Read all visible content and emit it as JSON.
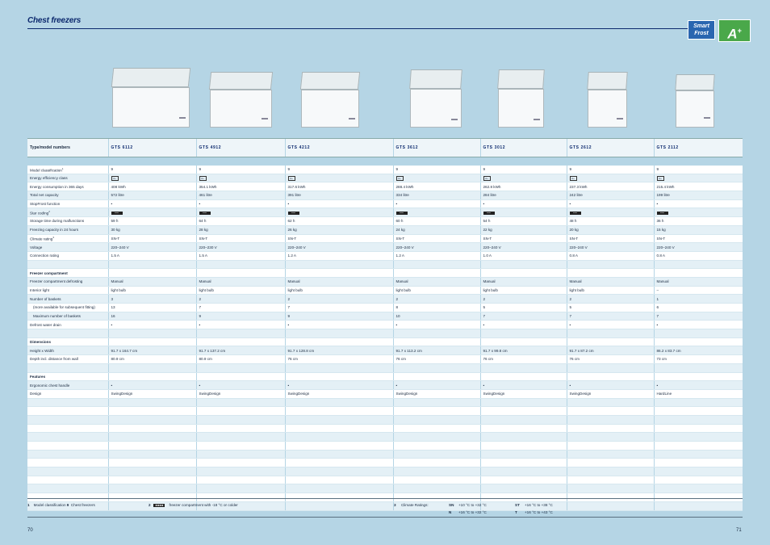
{
  "page_title": "Chest freezers",
  "logos": {
    "smartfrost_line1": "Smart",
    "smartfrost_line2": "Frost",
    "energy": "A",
    "energy_plus": "+"
  },
  "table": {
    "header_label": "Type/model numbers",
    "models": [
      "GTS 6112",
      "GTS 4912",
      "GTS 4212",
      "GTS 3612",
      "GTS 3012",
      "GTS 2612",
      "GTS 2112"
    ],
    "rows": [
      {
        "label": "Model classification",
        "sup": "1",
        "type": "w",
        "values": [
          "9",
          "9",
          "9",
          "9",
          "9",
          "9",
          "9"
        ]
      },
      {
        "label": "Energy efficiency class",
        "type": "b",
        "icon": "energy-class",
        "values": [
          "A+",
          "A+",
          "A+",
          "A+",
          "A+",
          "A+",
          "A+"
        ]
      },
      {
        "label": "Energy consumption in 365 days",
        "type": "w",
        "values": [
          "408 kWh",
          "354.1 kWh",
          "317.6 kWh",
          "288.4 kWh",
          "262.8 kWh",
          "237.3 kWh",
          "215.4 kWh"
        ]
      },
      {
        "label": "Total net capacity",
        "type": "b",
        "values": [
          "572 litre",
          "461 litre",
          "391 litre",
          "334 litre",
          "284 litre",
          "242 litre",
          "199 litre"
        ]
      },
      {
        "label": "StopFrost function",
        "type": "w",
        "values": [
          "•",
          "•",
          "•",
          "•",
          "•",
          "•",
          "•"
        ]
      },
      {
        "label": "Star coding",
        "sup": "2",
        "type": "b",
        "icon": "star-coding",
        "values": [
          "****",
          "****",
          "****",
          "****",
          "****",
          "****",
          "****"
        ]
      },
      {
        "label": "Storage time during malfunctions",
        "type": "w",
        "values": [
          "59 h",
          "64 h",
          "62 h",
          "60 h",
          "54 h",
          "48 h",
          "36 h"
        ]
      },
      {
        "label": "Freezing capacity in 24 hours",
        "type": "b",
        "values": [
          "30 kg",
          "28 kg",
          "26 kg",
          "24 kg",
          "22 kg",
          "20 kg",
          "15 kg"
        ]
      },
      {
        "label": "Climate rating",
        "sup": "3",
        "type": "w",
        "values": [
          "SN-T",
          "SN-T",
          "SN-T",
          "SN-T",
          "SN-T",
          "SN-T",
          "SN-T"
        ]
      },
      {
        "label": "Voltage",
        "type": "b",
        "values": [
          "220–240 V",
          "220–230 V",
          "220–240 V",
          "220–240 V",
          "220–240 V",
          "220–240 V",
          "220–240 V"
        ]
      },
      {
        "label": "Connection rating",
        "type": "w",
        "values": [
          "1.5 A",
          "1.5 A",
          "1.2 A",
          "1.2 A",
          "1.0 A",
          "0.8 A",
          "0.8 A"
        ]
      },
      {
        "label": "",
        "type": "b",
        "values": [
          "",
          "",
          "",
          "",
          "",
          "",
          ""
        ]
      },
      {
        "label": "Freezer compartment",
        "type": "w",
        "section": true,
        "values": [
          "",
          "",
          "",
          "",
          "",
          "",
          ""
        ]
      },
      {
        "label": "Freezer compartment defrosting",
        "type": "b",
        "values": [
          "Manual",
          "Manual",
          "Manual",
          "Manual",
          "Manual",
          "Manual",
          "Manual"
        ]
      },
      {
        "label": "Interior light",
        "type": "w",
        "values": [
          "light bulb",
          "light bulb",
          "light bulb",
          "light bulb",
          "light bulb",
          "light bulb",
          "–"
        ]
      },
      {
        "label": "Number of baskets",
        "type": "b",
        "values": [
          "3",
          "2",
          "2",
          "2",
          "2",
          "2",
          "1"
        ]
      },
      {
        "label": "(more available for subsequent fitting)",
        "type": "w",
        "indent": true,
        "values": [
          "13",
          "7",
          "7",
          "8",
          "5",
          "5",
          "6"
        ]
      },
      {
        "label": "Maximum number of baskets",
        "type": "b",
        "indent": true,
        "values": [
          "16",
          "9",
          "9",
          "10",
          "7",
          "7",
          "7"
        ]
      },
      {
        "label": "Defrost water drain",
        "type": "w",
        "values": [
          "•",
          "•",
          "•",
          "•",
          "•",
          "•",
          "•"
        ]
      },
      {
        "label": "",
        "type": "b",
        "values": [
          "",
          "",
          "",
          "",
          "",
          "",
          ""
        ]
      },
      {
        "label": "Dimensions",
        "type": "w",
        "section": true,
        "values": [
          "",
          "",
          "",
          "",
          "",
          "",
          ""
        ]
      },
      {
        "label": "Height x Width",
        "type": "b",
        "values": [
          "91.7 x 164.7 cm",
          "91.7 x 137.2 cm",
          "91.7 x 128.8 cm",
          "91.7 x 113.2 cm",
          "91.7 x 99.8 cm",
          "91.7 x 87.2 cm",
          "86.2 x 83.7 cm"
        ]
      },
      {
        "label": "Depth incl. distance from wall",
        "type": "w",
        "values": [
          "80.9 cm",
          "80.9 cm",
          "76 cm",
          "76 cm",
          "76 cm",
          "76 cm",
          "73 cm"
        ]
      },
      {
        "label": "",
        "type": "b",
        "values": [
          "",
          "",
          "",
          "",
          "",
          "",
          ""
        ]
      },
      {
        "label": "Features",
        "type": "w",
        "section": true,
        "values": [
          "",
          "",
          "",
          "",
          "",
          "",
          ""
        ]
      },
      {
        "label": "Ergonomic chest handle",
        "type": "b",
        "values": [
          "•",
          "•",
          "•",
          "•",
          "•",
          "•",
          "•"
        ]
      },
      {
        "label": "Design",
        "type": "w",
        "values": [
          "SwingDesign",
          "SwingDesign",
          "SwingDesign",
          "SwingDesign",
          "SwingDesign",
          "SwingDesign",
          "HardLine"
        ]
      }
    ],
    "empty_rows": 13
  },
  "footnotes": {
    "fn1_num": "1",
    "fn1_label": "Model classification",
    "fn1_value": "9",
    "fn1_text": "Chest freezers",
    "fn2_num": "2",
    "fn2_text": "freezer compartment with -18 °C or colder",
    "fn3_num": "3",
    "fn3_label": "Climate Ratings:",
    "ratings": [
      {
        "code": "SN",
        "range": "+10 °C to +32 °C"
      },
      {
        "code": "N",
        "range": "+16 °C to +32 °C"
      },
      {
        "code": "ST",
        "range": "+16 °C to +38 °C"
      },
      {
        "code": "T",
        "range": "+16 °C to +43 °C"
      }
    ]
  },
  "page_left": "70",
  "page_right": "71"
}
